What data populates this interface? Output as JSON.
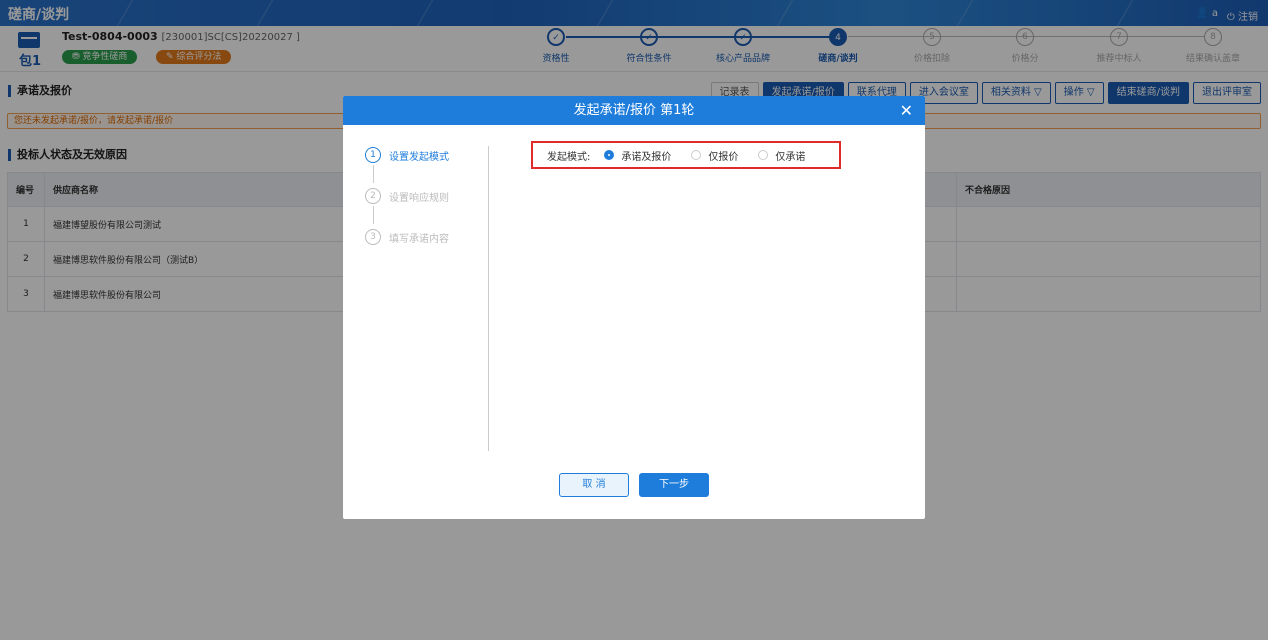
{
  "app": {
    "title": "磋商/谈判",
    "user": "a",
    "logout": "注销"
  },
  "project": {
    "package": "包1",
    "name": "Test-0804-0003",
    "code": "[230001]SC[CS]20220027 ]",
    "badge_method": "竞争性磋商",
    "badge_eval": "综合评分法"
  },
  "steps": [
    {
      "label": "资格性",
      "mark": "✓",
      "state": "done"
    },
    {
      "label": "符合性条件",
      "mark": "✓",
      "state": "done"
    },
    {
      "label": "核心产品品牌",
      "mark": "✓",
      "state": "done"
    },
    {
      "label": "磋商/谈判",
      "mark": "4",
      "state": "cur"
    },
    {
      "label": "价格扣除",
      "mark": "5",
      "state": "todo"
    },
    {
      "label": "价格分",
      "mark": "6",
      "state": "todo"
    },
    {
      "label": "推荐中标人",
      "mark": "7",
      "state": "todo"
    },
    {
      "label": "结果确认盖章",
      "mark": "8",
      "state": "todo"
    }
  ],
  "section1": {
    "title": "承诺及报价"
  },
  "toolbar": [
    "记录表",
    "发起承诺/报价",
    "联系代理",
    "进入会议室",
    "相关资料 ▽",
    "操作 ▽",
    "结束磋商/谈判",
    "退出评审室"
  ],
  "warning": "您还未发起承诺/报价，请发起承诺/报价",
  "section2": {
    "title": "投标人状态及无效原因"
  },
  "table": {
    "headers": [
      "编号",
      "供应商名称",
      "不合格原因"
    ],
    "rows": [
      {
        "no": "1",
        "name": "福建博望股份有限公司测试",
        "reason": ""
      },
      {
        "no": "2",
        "name": "福建博思软件股份有限公司（测试B）",
        "reason": ""
      },
      {
        "no": "3",
        "name": "福建博思软件股份有限公司",
        "reason": ""
      }
    ]
  },
  "modal": {
    "title": "发起承诺/报价 第1轮",
    "close": "✕",
    "steps": [
      {
        "no": "1",
        "label": "设置发起模式"
      },
      {
        "no": "2",
        "label": "设置响应规则"
      },
      {
        "no": "3",
        "label": "填写承诺内容"
      }
    ],
    "mode_label": "发起模式:",
    "options": [
      "承诺及报价",
      "仅报价",
      "仅承诺"
    ],
    "selected": "承诺及报价",
    "cancel": "取 消",
    "next": "下一步"
  },
  "colors": {
    "primary": "#1c5db3",
    "modal_header": "#1e7ddb",
    "highlight": "#e02b2b",
    "warning": "#e06a00"
  }
}
